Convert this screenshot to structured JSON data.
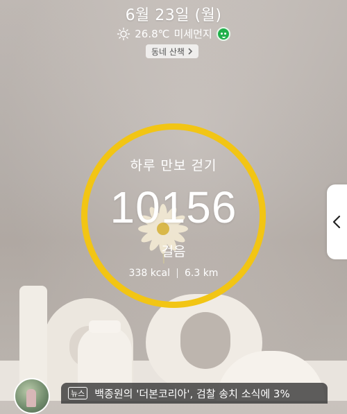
{
  "header": {
    "date": "6월 23일 (월)",
    "temperature": "26.8℃",
    "dust_label": "미세먼지",
    "walk_chip_label": "동네 산책"
  },
  "step_widget": {
    "title": "하루 만보 걷기",
    "steps": "10156",
    "unit": "걸음",
    "calories": "338 kcal",
    "distance": "6.3 km",
    "ring_color": "#f2c514"
  },
  "news": {
    "badge": "뉴스",
    "headline": "백종원의 '더본코리아', 검찰 송치 소식에 3%"
  },
  "icons": {
    "weather": "sun-icon",
    "dust_status": "smiley-icon",
    "chip_arrow": "chevron-right-icon",
    "side_handle": "chevron-left-icon"
  },
  "colors": {
    "dust_good": "#21b04b",
    "ring": "#f2c514"
  }
}
